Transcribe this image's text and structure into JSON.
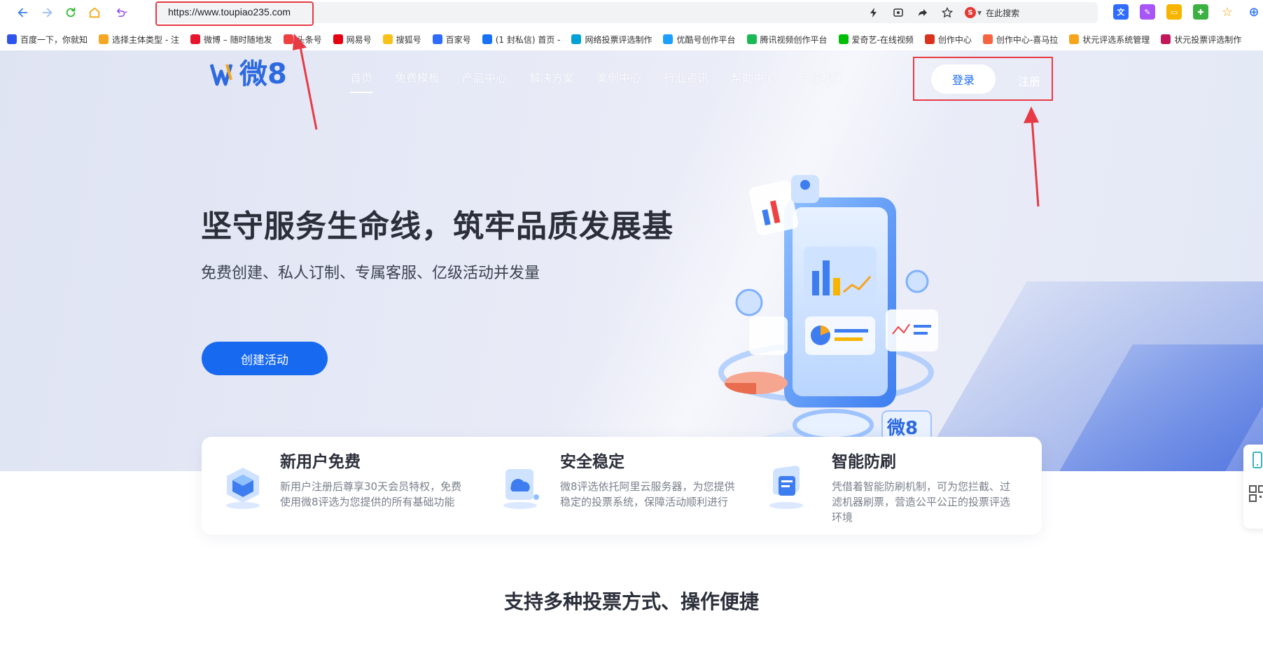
{
  "browser": {
    "url": "https://www.toupiao235.com",
    "search_placeholder": "在此搜索",
    "search_engine_letter": "S"
  },
  "bookmarks": [
    {
      "label": "百度一下，你就知",
      "color": "#2f54eb"
    },
    {
      "label": "选择主体类型 - 注",
      "color": "#f5a623"
    },
    {
      "label": "微博 – 随时随地发",
      "color": "#e6162d"
    },
    {
      "label": "头条号",
      "color": "#f04142"
    },
    {
      "label": "网易号",
      "color": "#e60012"
    },
    {
      "label": "搜狐号",
      "color": "#f8c21b"
    },
    {
      "label": "百家号",
      "color": "#2f6bff"
    },
    {
      "label": "(1 封私信) 首页 -",
      "color": "#1772f6"
    },
    {
      "label": "网络投票评选制作",
      "color": "#00a1d6"
    },
    {
      "label": "优酷号创作平台",
      "color": "#1ba0ff"
    },
    {
      "label": "腾讯视频创作平台",
      "color": "#19b955"
    },
    {
      "label": "爱奇艺-在线视频",
      "color": "#00be06"
    },
    {
      "label": "创作中心",
      "color": "#d9331e"
    },
    {
      "label": "创作中心-喜马拉",
      "color": "#f86442"
    },
    {
      "label": "状元评选系统管理",
      "color": "#f7a51c"
    },
    {
      "label": "状元投票评选制作",
      "color": "#c2185b"
    }
  ],
  "site": {
    "logo_text": "微8",
    "nav": [
      "首页",
      "免费模板",
      "产品中心",
      "解决方案",
      "案例中心",
      "行业资讯",
      "帮助中心",
      "了解我们"
    ],
    "login_label": "登录",
    "register_label": "注册"
  },
  "hero": {
    "title": "坚守服务生命线，筑牢品质发展基",
    "subtitle": "免费创建、私人订制、专属客服、亿级活动并发量",
    "cta_label": "创建活动",
    "badge_text": "微8"
  },
  "features": [
    {
      "title": "新用户免费",
      "desc": "新用户注册后尊享30天会员特权，免费使用微8评选为您提供的所有基础功能"
    },
    {
      "title": "安全稳定",
      "desc": "微8评选依托阿里云服务器，为您提供稳定的投票系统，保障活动顺利进行"
    },
    {
      "title": "智能防刷",
      "desc": "凭借着智能防刷机制，可为您拦截、过滤机器刷票，营造公平公正的投票评选环境"
    }
  ],
  "section": {
    "title": "支持多种投票方式、操作便捷"
  },
  "colors": {
    "primary": "#1769f0",
    "annotation_red": "#e83a45",
    "text_dark": "#2b2f3a",
    "text_muted": "#7a808c"
  }
}
